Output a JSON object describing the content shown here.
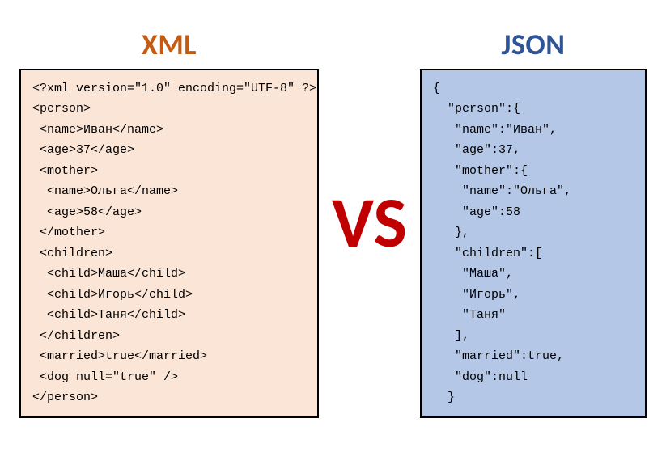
{
  "left": {
    "title": "XML",
    "code": "<?xml version=\"1.0\" encoding=\"UTF-8\" ?>\n<person>\n <name>Иван</name>\n <age>37</age>\n <mother>\n  <name>Ольга</name>\n  <age>58</age>\n </mother>\n <children>\n  <child>Маша</child>\n  <child>Игорь</child>\n  <child>Таня</child>\n </children>\n <married>true</married>\n <dog null=\"true\" />\n</person>"
  },
  "vs": "VS",
  "right": {
    "title": "JSON",
    "code": "{\n  \"person\":{\n   \"name\":\"Иван\",\n   \"age\":37,\n   \"mother\":{\n    \"name\":\"Ольга\",\n    \"age\":58\n   },\n   \"children\":[\n    \"Маша\",\n    \"Игорь\",\n    \"Таня\"\n   ],\n   \"married\":true,\n   \"dog\":null\n  }"
  }
}
